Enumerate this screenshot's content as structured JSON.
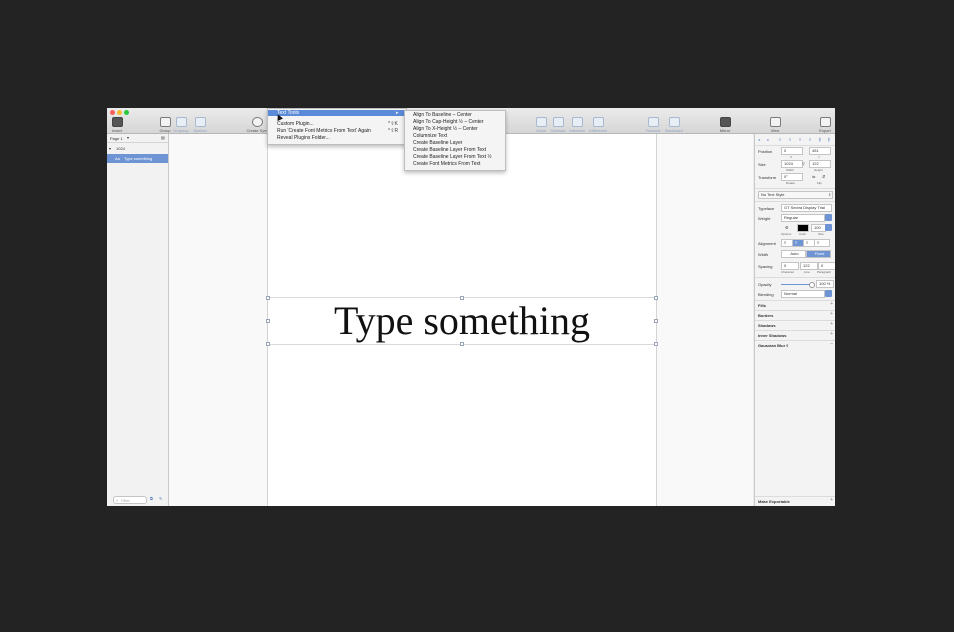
{
  "toolbar": {
    "insert": "Insert",
    "group": "Group",
    "ungroup": "Ungroup",
    "symbol": "Symbol",
    "create_symbol": "Create Sym",
    "union": "Union",
    "subtract": "Subtract",
    "intersect": "Intersect",
    "difference": "Difference",
    "forward": "Forward",
    "backward": "Backward",
    "mirror": "Mirror",
    "view": "View",
    "export": "Export"
  },
  "sidebar": {
    "page_selector": "Page 1",
    "artboard_name": "1024",
    "selected_layer": "Type something",
    "filter_placeholder": "Filter"
  },
  "canvas": {
    "headline": "Type something"
  },
  "plugin_menu": {
    "header": "Text Tools",
    "items": [
      {
        "label": "Custom Plugin...",
        "shortcut": "^⇧K"
      },
      {
        "label": "Run 'Create Font Metrics From Text' Again",
        "shortcut": "^⇧R"
      },
      {
        "label": "Reveal Plugins Folder...",
        "shortcut": ""
      }
    ]
  },
  "submenu": {
    "items": [
      "Align To Baseline – Center",
      "Align To Cap-Height ½ – Center",
      "Align To X-Height ½ – Center",
      "Columnize Text",
      "Create Baseline Layer",
      "Create Baseline Layer From Text",
      "Create Baseline Layer From Text ½",
      "Create Font Metrics From Text"
    ]
  },
  "inspector": {
    "position_label": "Position",
    "x": "0",
    "y": "451",
    "x_label": "X",
    "y_label": "Y",
    "size_label": "Size",
    "width": "1024",
    "height": "122",
    "width_label": "Width",
    "height_label": "Height",
    "transform_label": "Transform",
    "rotate": "0°",
    "rotate_label": "Rotate",
    "flip_label": "Flip",
    "text_style": "No Text Style",
    "typeface_label": "Typeface",
    "typeface": "GT Sectra Display Trial",
    "weight_label": "Weight",
    "weight": "Regular",
    "options_label": "Options",
    "color_label": "Color",
    "font_size": "100",
    "size_sub_label": "Size",
    "alignment_label": "Alignment",
    "width_mode_label": "Width",
    "width_auto": "Auto",
    "width_fixed": "Fixed",
    "spacing_label": "Spacing",
    "char_spacing": "0",
    "line_spacing": "122",
    "para_spacing": "0",
    "character_label": "Character",
    "line_label": "Line",
    "paragraph_label": "Paragraph",
    "opacity_label": "Opacity",
    "opacity_value": "100 %",
    "blending_label": "Blending",
    "blending_value": "Normal",
    "fills_label": "Fills",
    "borders_label": "Borders",
    "shadows_label": "Shadows",
    "inner_shadows_label": "Inner Shadows",
    "gaussian_blur_label": "Gaussian Blur ◊",
    "make_exportable": "Make Exportable",
    "color_swatch": "#000000"
  },
  "colors": {
    "accent": "#5b8ad8",
    "selected_layer": "#6e94d4",
    "background": "#232323"
  }
}
